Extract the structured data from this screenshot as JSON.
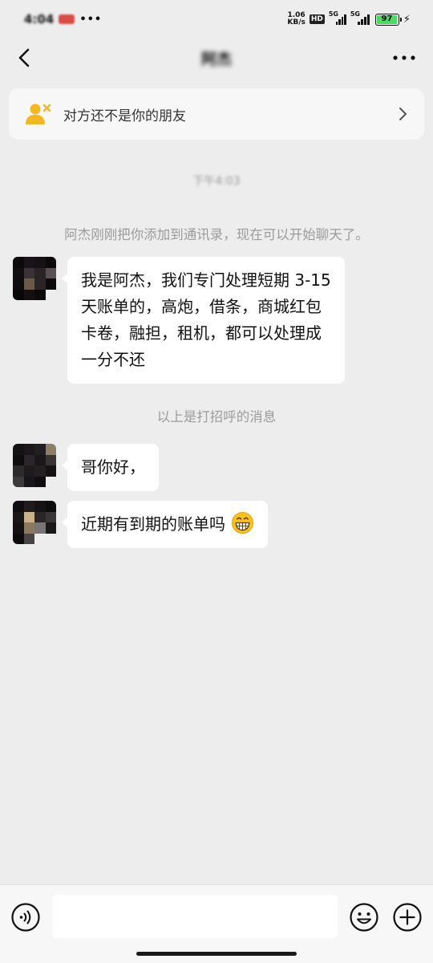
{
  "status_bar": {
    "time": "4:04",
    "notification_dots": "•••",
    "net_speed_value": "1.06",
    "net_speed_unit": "KB/s",
    "hd_label": "HD",
    "signal_1_label": "5G",
    "signal_2_label": "5G",
    "battery_level": "97",
    "battery_color": "#4cd964"
  },
  "nav": {
    "title": "阿杰",
    "back_icon": "chevron-left-icon",
    "more_icon": "more-icon"
  },
  "banner": {
    "icon": "user-remove-icon",
    "text": "对方还不是你的朋友",
    "icon_color": "#f2b822"
  },
  "chat": {
    "time_label": "下午4:03",
    "system_message": "阿杰刚刚把你添加到通讯录，现在可以开始聊天了。",
    "greeting_hint": "以上是打招呼的消息",
    "messages": [
      {
        "lines": [
          "我是阿杰，我们专门处理短期 3-15",
          "天账单的，高炮，借条，商城红包",
          "卡卷，融担，租机，都可以处理成",
          "一分不还"
        ]
      },
      {
        "text": "哥你好，"
      },
      {
        "text": "近期有到期的账单吗",
        "emoji": "grinning-face-icon"
      }
    ]
  },
  "input_bar": {
    "voice_icon": "voice-icon",
    "emoji_icon": "smile-icon",
    "plus_icon": "plus-icon",
    "input_value": ""
  }
}
